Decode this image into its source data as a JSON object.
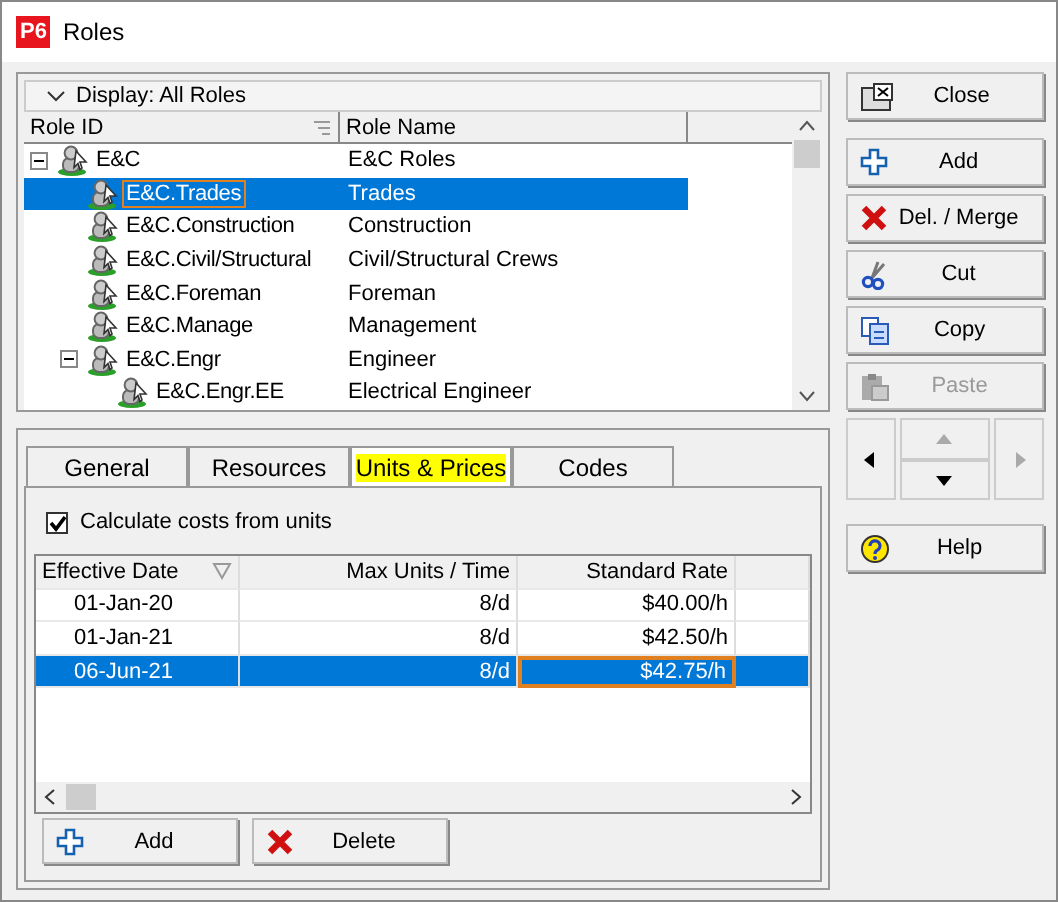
{
  "window": {
    "app_badge": "P6",
    "title": "Roles"
  },
  "tree": {
    "display_label": "Display: All Roles",
    "columns": [
      "Role ID",
      "Role Name"
    ],
    "nodes": [
      {
        "id": "E&C",
        "name": "E&C Roles",
        "expanded": true,
        "selected": false,
        "children": [
          {
            "id": "E&C.Trades",
            "name": "Trades",
            "selected": true
          },
          {
            "id": "E&C.Construction",
            "name": "Construction",
            "selected": false
          },
          {
            "id": "E&C.Civil/Structural",
            "name": "Civil/Structural Crews",
            "selected": false
          },
          {
            "id": "E&C.Foreman",
            "name": "Foreman",
            "selected": false
          },
          {
            "id": "E&C.Manage",
            "name": "Management",
            "selected": false
          },
          {
            "id": "E&C.Engr",
            "name": "Engineer",
            "expanded": true,
            "selected": false,
            "children": [
              {
                "id": "E&C.Engr.EE",
                "name": "Electrical Engineer",
                "selected": false
              }
            ]
          }
        ]
      }
    ]
  },
  "tabs": [
    {
      "label": "General",
      "selected": false
    },
    {
      "label": "Resources",
      "selected": false
    },
    {
      "label": "Units & Prices",
      "selected": true
    },
    {
      "label": "Codes",
      "selected": false
    }
  ],
  "calculate_costs": {
    "label": "Calculate costs from units",
    "checked": true
  },
  "prices": {
    "columns": [
      "Effective Date",
      "Max Units / Time",
      "Standard Rate"
    ],
    "rows": [
      {
        "cells": [
          "01-Jan-20",
          "8/d",
          "$40.00/h"
        ],
        "selected": false
      },
      {
        "cells": [
          "01-Jan-21",
          "8/d",
          "$42.50/h"
        ],
        "selected": false
      },
      {
        "cells": [
          "06-Jun-21",
          "8/d",
          "$42.75/h"
        ],
        "selected": true
      }
    ]
  },
  "price_buttons": [
    {
      "kind": "add",
      "label": "Add"
    },
    {
      "kind": "delete",
      "label": "Delete"
    }
  ],
  "side_buttons": [
    {
      "kind": "close",
      "label": "Close",
      "disabled": false
    },
    {
      "kind": "add",
      "label": "Add",
      "disabled": false
    },
    {
      "kind": "delete",
      "label": "Del. / Merge",
      "disabled": false
    },
    {
      "kind": "cut",
      "label": "Cut",
      "disabled": false
    },
    {
      "kind": "copy",
      "label": "Copy",
      "disabled": false
    },
    {
      "kind": "paste",
      "label": "Paste",
      "disabled": true
    }
  ],
  "nav": {
    "left": {
      "disabled": false
    },
    "up": {
      "disabled": true
    },
    "down": {
      "disabled": false
    },
    "right": {
      "disabled": true
    }
  },
  "help_button": {
    "label": "Help"
  }
}
